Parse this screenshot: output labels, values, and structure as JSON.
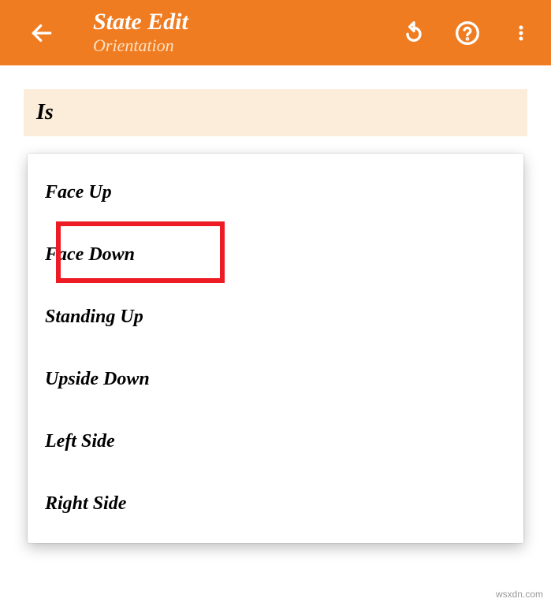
{
  "header": {
    "title": "State Edit",
    "subtitle": "Orientation"
  },
  "section": {
    "label": "Is"
  },
  "options": [
    "Face Up",
    "Face Down",
    "Standing Up",
    "Upside Down",
    "Left Side",
    "Right Side"
  ],
  "watermark": "wsxdn.com"
}
